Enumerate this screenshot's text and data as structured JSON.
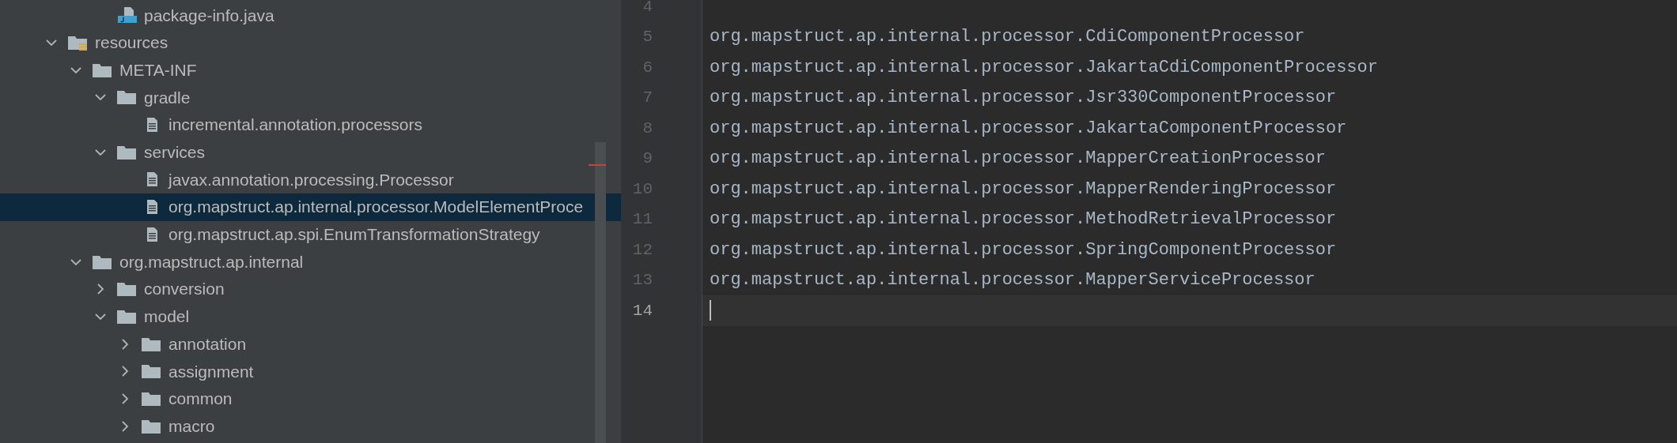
{
  "project_tree": {
    "leading_items": [
      {
        "label": "package-info.java",
        "kind": "java",
        "selected": false
      }
    ],
    "items": [
      {
        "label": "resources",
        "kind": "resources",
        "expanded": true,
        "selected": false,
        "children": [
          {
            "label": "META-INF",
            "kind": "folder",
            "expanded": true,
            "selected": false,
            "children": [
              {
                "label": "gradle",
                "kind": "folder",
                "expanded": true,
                "selected": false,
                "children": [
                  {
                    "label": "incremental.annotation.processors",
                    "kind": "file",
                    "selected": false
                  }
                ]
              },
              {
                "label": "services",
                "kind": "folder",
                "expanded": true,
                "selected": false,
                "children": [
                  {
                    "label": "javax.annotation.processing.Processor",
                    "kind": "file",
                    "selected": false
                  },
                  {
                    "label": "org.mapstruct.ap.internal.processor.ModelElementProce",
                    "kind": "file",
                    "selected": true
                  },
                  {
                    "label": "org.mapstruct.ap.spi.EnumTransformationStrategy",
                    "kind": "file",
                    "selected": false
                  }
                ]
              }
            ]
          },
          {
            "label": "org.mapstruct.ap.internal",
            "kind": "folder",
            "expanded": true,
            "selected": false,
            "children": [
              {
                "label": "conversion",
                "kind": "folder",
                "expanded": false,
                "selected": false
              },
              {
                "label": "model",
                "kind": "folder",
                "expanded": true,
                "selected": false,
                "children": [
                  {
                    "label": "annotation",
                    "kind": "folder",
                    "expanded": false,
                    "selected": false
                  },
                  {
                    "label": "assignment",
                    "kind": "folder",
                    "expanded": false,
                    "selected": false
                  },
                  {
                    "label": "common",
                    "kind": "folder",
                    "expanded": false,
                    "selected": false
                  },
                  {
                    "label": "macro",
                    "kind": "folder",
                    "expanded": false,
                    "selected": false
                  }
                ]
              }
            ]
          }
        ]
      }
    ]
  },
  "editor": {
    "lines": [
      {
        "number": "4",
        "current": false
      },
      {
        "number": "5",
        "text": "org.mapstruct.ap.internal.processor.CdiComponentProcessor",
        "current": false
      },
      {
        "number": "6",
        "text": "org.mapstruct.ap.internal.processor.JakartaCdiComponentProcessor",
        "current": false
      },
      {
        "number": "7",
        "text": "org.mapstruct.ap.internal.processor.Jsr330ComponentProcessor",
        "current": false
      },
      {
        "number": "8",
        "text": "org.mapstruct.ap.internal.processor.JakartaComponentProcessor",
        "current": false
      },
      {
        "number": "9",
        "text": "org.mapstruct.ap.internal.processor.MapperCreationProcessor",
        "current": false
      },
      {
        "number": "10",
        "text": "org.mapstruct.ap.internal.processor.MapperRenderingProcessor",
        "current": false
      },
      {
        "number": "11",
        "text": "org.mapstruct.ap.internal.processor.MethodRetrievalProcessor",
        "current": false
      },
      {
        "number": "12",
        "text": "org.mapstruct.ap.internal.processor.SpringComponentProcessor",
        "current": false
      },
      {
        "number": "13",
        "text": "org.mapstruct.ap.internal.processor.MapperServiceProcessor",
        "current": false
      },
      {
        "number": "14",
        "current": true
      }
    ]
  }
}
